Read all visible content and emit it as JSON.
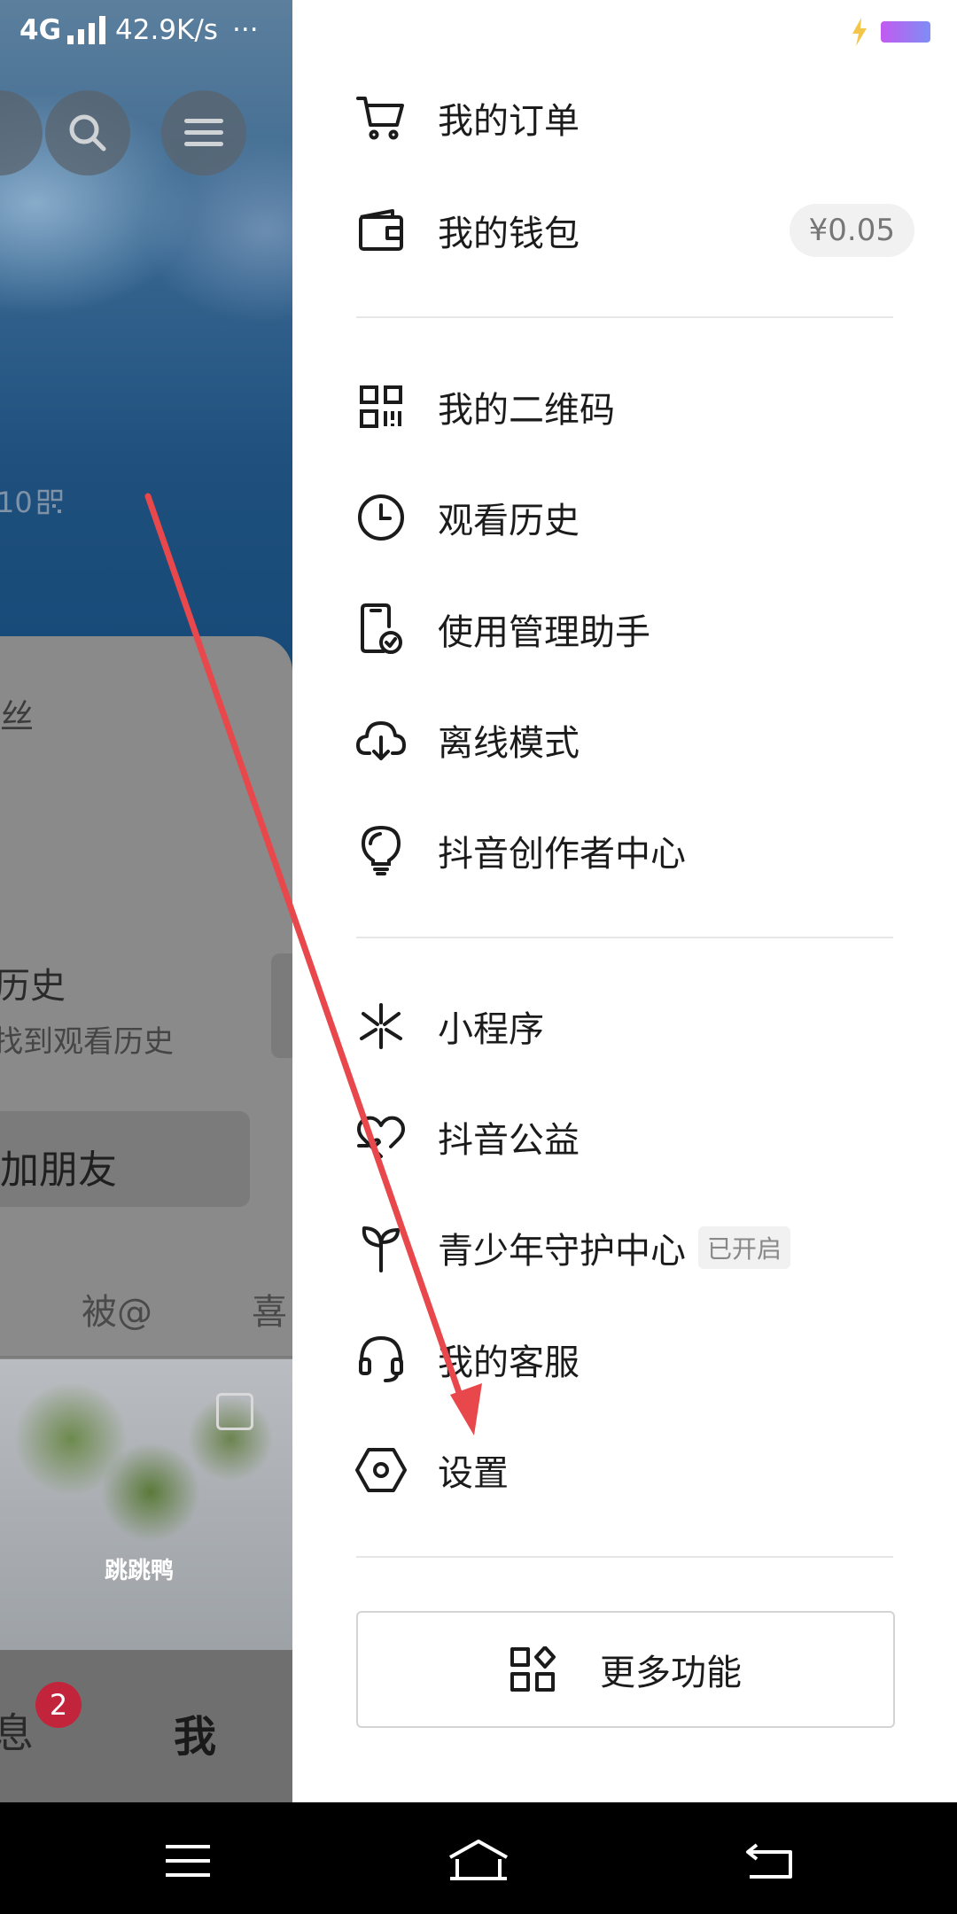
{
  "status_bar": {
    "network": "4G",
    "speed": "42.9K/s",
    "more": "···"
  },
  "background_page": {
    "fans_label": "丝",
    "id_fragment": "10",
    "history_title": "历史",
    "history_subtitle": "找到观看历史",
    "add_friend": "加朋友",
    "tab_mentions": "被@",
    "tab_likes": "喜",
    "thumb_caption": "跳跳鸭",
    "nav_messages": "息",
    "nav_messages_badge": "2",
    "nav_me": "我"
  },
  "drawer": {
    "orders": "我的订单",
    "wallet": "我的钱包",
    "wallet_balance": "¥0.05",
    "qr_code": "我的二维码",
    "watch_history": "观看历史",
    "usage_assistant": "使用管理助手",
    "offline_mode": "离线模式",
    "creator_center": "抖音创作者中心",
    "mini_programs": "小程序",
    "charity": "抖音公益",
    "youth_protection": "青少年守护中心",
    "youth_protection_tag": "已开启",
    "customer_service": "我的客服",
    "settings": "设置",
    "more_features": "更多功能"
  },
  "colors": {
    "annotation_arrow": "#e8484b",
    "badge": "#c2243b"
  }
}
